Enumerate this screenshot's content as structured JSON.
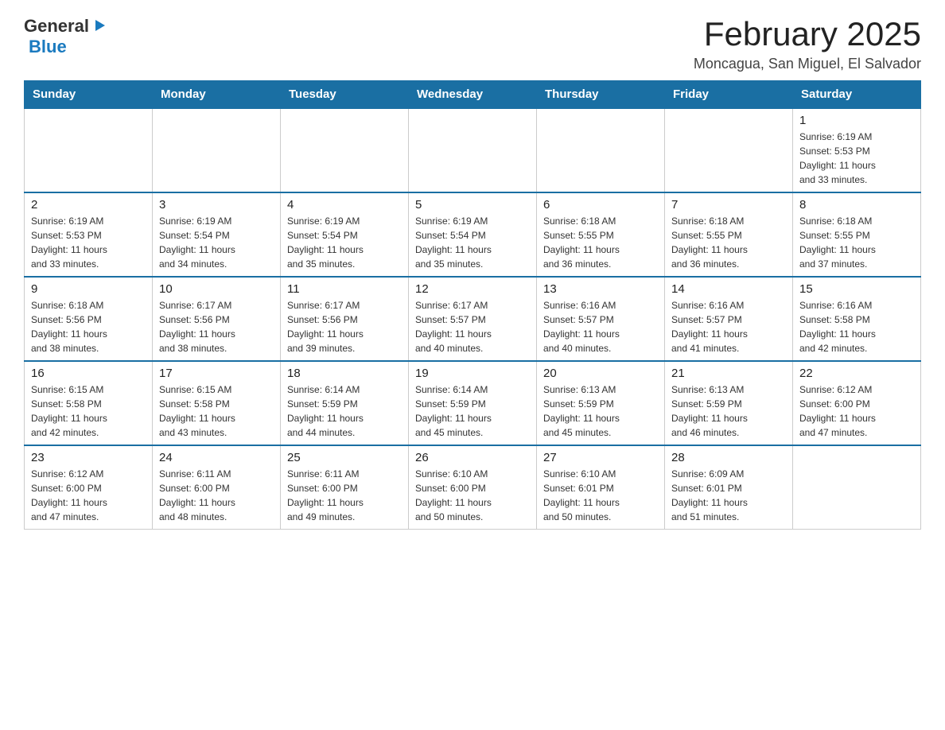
{
  "header": {
    "logo": {
      "general": "General",
      "triangle": "▶",
      "blue": "Blue"
    },
    "title": "February 2025",
    "subtitle": "Moncagua, San Miguel, El Salvador"
  },
  "weekdays": [
    "Sunday",
    "Monday",
    "Tuesday",
    "Wednesday",
    "Thursday",
    "Friday",
    "Saturday"
  ],
  "weeks": [
    [
      {
        "day": "",
        "info": ""
      },
      {
        "day": "",
        "info": ""
      },
      {
        "day": "",
        "info": ""
      },
      {
        "day": "",
        "info": ""
      },
      {
        "day": "",
        "info": ""
      },
      {
        "day": "",
        "info": ""
      },
      {
        "day": "1",
        "info": "Sunrise: 6:19 AM\nSunset: 5:53 PM\nDaylight: 11 hours\nand 33 minutes."
      }
    ],
    [
      {
        "day": "2",
        "info": "Sunrise: 6:19 AM\nSunset: 5:53 PM\nDaylight: 11 hours\nand 33 minutes."
      },
      {
        "day": "3",
        "info": "Sunrise: 6:19 AM\nSunset: 5:54 PM\nDaylight: 11 hours\nand 34 minutes."
      },
      {
        "day": "4",
        "info": "Sunrise: 6:19 AM\nSunset: 5:54 PM\nDaylight: 11 hours\nand 35 minutes."
      },
      {
        "day": "5",
        "info": "Sunrise: 6:19 AM\nSunset: 5:54 PM\nDaylight: 11 hours\nand 35 minutes."
      },
      {
        "day": "6",
        "info": "Sunrise: 6:18 AM\nSunset: 5:55 PM\nDaylight: 11 hours\nand 36 minutes."
      },
      {
        "day": "7",
        "info": "Sunrise: 6:18 AM\nSunset: 5:55 PM\nDaylight: 11 hours\nand 36 minutes."
      },
      {
        "day": "8",
        "info": "Sunrise: 6:18 AM\nSunset: 5:55 PM\nDaylight: 11 hours\nand 37 minutes."
      }
    ],
    [
      {
        "day": "9",
        "info": "Sunrise: 6:18 AM\nSunset: 5:56 PM\nDaylight: 11 hours\nand 38 minutes."
      },
      {
        "day": "10",
        "info": "Sunrise: 6:17 AM\nSunset: 5:56 PM\nDaylight: 11 hours\nand 38 minutes."
      },
      {
        "day": "11",
        "info": "Sunrise: 6:17 AM\nSunset: 5:56 PM\nDaylight: 11 hours\nand 39 minutes."
      },
      {
        "day": "12",
        "info": "Sunrise: 6:17 AM\nSunset: 5:57 PM\nDaylight: 11 hours\nand 40 minutes."
      },
      {
        "day": "13",
        "info": "Sunrise: 6:16 AM\nSunset: 5:57 PM\nDaylight: 11 hours\nand 40 minutes."
      },
      {
        "day": "14",
        "info": "Sunrise: 6:16 AM\nSunset: 5:57 PM\nDaylight: 11 hours\nand 41 minutes."
      },
      {
        "day": "15",
        "info": "Sunrise: 6:16 AM\nSunset: 5:58 PM\nDaylight: 11 hours\nand 42 minutes."
      }
    ],
    [
      {
        "day": "16",
        "info": "Sunrise: 6:15 AM\nSunset: 5:58 PM\nDaylight: 11 hours\nand 42 minutes."
      },
      {
        "day": "17",
        "info": "Sunrise: 6:15 AM\nSunset: 5:58 PM\nDaylight: 11 hours\nand 43 minutes."
      },
      {
        "day": "18",
        "info": "Sunrise: 6:14 AM\nSunset: 5:59 PM\nDaylight: 11 hours\nand 44 minutes."
      },
      {
        "day": "19",
        "info": "Sunrise: 6:14 AM\nSunset: 5:59 PM\nDaylight: 11 hours\nand 45 minutes."
      },
      {
        "day": "20",
        "info": "Sunrise: 6:13 AM\nSunset: 5:59 PM\nDaylight: 11 hours\nand 45 minutes."
      },
      {
        "day": "21",
        "info": "Sunrise: 6:13 AM\nSunset: 5:59 PM\nDaylight: 11 hours\nand 46 minutes."
      },
      {
        "day": "22",
        "info": "Sunrise: 6:12 AM\nSunset: 6:00 PM\nDaylight: 11 hours\nand 47 minutes."
      }
    ],
    [
      {
        "day": "23",
        "info": "Sunrise: 6:12 AM\nSunset: 6:00 PM\nDaylight: 11 hours\nand 47 minutes."
      },
      {
        "day": "24",
        "info": "Sunrise: 6:11 AM\nSunset: 6:00 PM\nDaylight: 11 hours\nand 48 minutes."
      },
      {
        "day": "25",
        "info": "Sunrise: 6:11 AM\nSunset: 6:00 PM\nDaylight: 11 hours\nand 49 minutes."
      },
      {
        "day": "26",
        "info": "Sunrise: 6:10 AM\nSunset: 6:00 PM\nDaylight: 11 hours\nand 50 minutes."
      },
      {
        "day": "27",
        "info": "Sunrise: 6:10 AM\nSunset: 6:01 PM\nDaylight: 11 hours\nand 50 minutes."
      },
      {
        "day": "28",
        "info": "Sunrise: 6:09 AM\nSunset: 6:01 PM\nDaylight: 11 hours\nand 51 minutes."
      },
      {
        "day": "",
        "info": ""
      }
    ]
  ]
}
